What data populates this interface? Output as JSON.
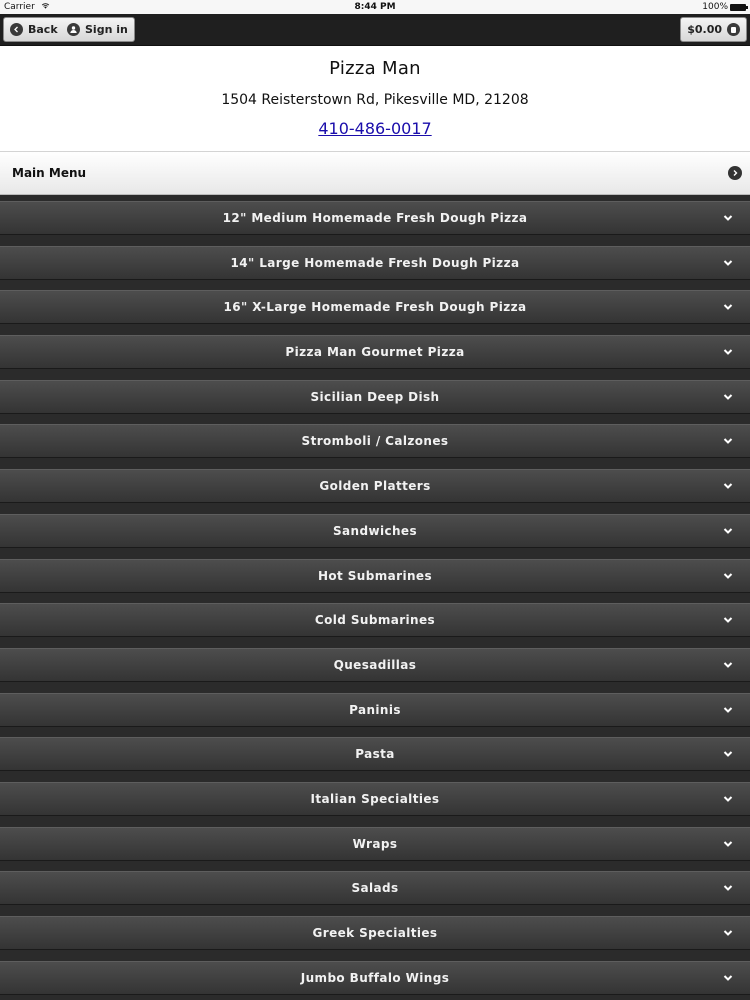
{
  "status": {
    "carrier": "Carrier",
    "time": "8:44 PM",
    "battery": "100%"
  },
  "toolbar": {
    "back": "Back",
    "signin": "Sign in",
    "cart": "$0.00"
  },
  "restaurant": {
    "name": "Pizza Man",
    "address": "1504 Reisterstown Rd, Pikesville MD, 21208",
    "phone": "410-486-0017"
  },
  "menu": {
    "title": "Main Menu",
    "categories": [
      "12\" Medium Homemade Fresh Dough Pizza",
      "14\" Large Homemade Fresh Dough Pizza",
      "16\" X-Large Homemade Fresh Dough Pizza",
      "Pizza Man Gourmet Pizza",
      "Sicilian Deep Dish",
      "Stromboli / Calzones",
      "Golden Platters",
      "Sandwiches",
      "Hot Submarines",
      "Cold Submarines",
      "Quesadillas",
      "Paninis",
      "Pasta",
      "Italian Specialties",
      "Wraps",
      "Salads",
      "Greek Specialties",
      "Jumbo Buffalo Wings"
    ]
  }
}
